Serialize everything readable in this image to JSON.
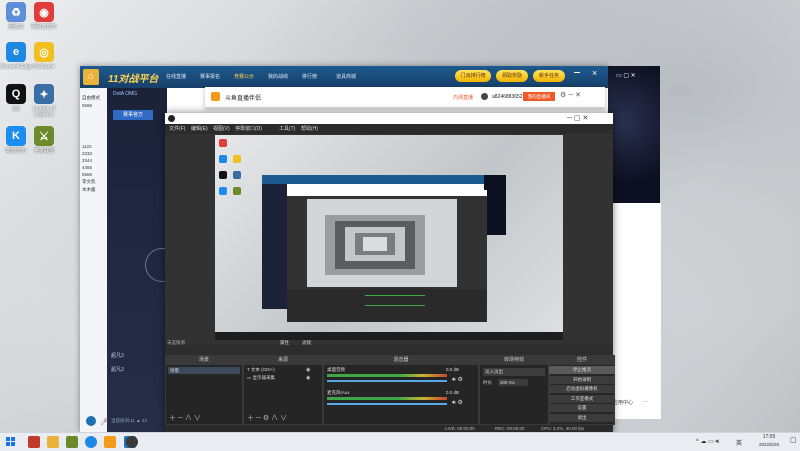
{
  "desktop": {
    "icons": [
      {
        "label": "回收站",
        "color": "#5b8fd6",
        "glyph": "♻"
      },
      {
        "label": "网易云音乐",
        "color": "#e23c3c",
        "glyph": "◉"
      },
      {
        "label": "Microsoft Edge",
        "color": "#1e88e5",
        "glyph": "e"
      },
      {
        "label": "WeGame",
        "color": "#f2c01e",
        "glyph": "◎"
      },
      {
        "label": "QQ",
        "color": "#111111",
        "glyph": "Q"
      },
      {
        "label": "League of Legends",
        "color": "#3a6ea5",
        "glyph": "✦"
      },
      {
        "label": "酷狗音乐",
        "color": "#1c8cf0",
        "glyph": "K"
      },
      {
        "label": "英雄联盟",
        "color": "#6d8a2a",
        "glyph": "⚔"
      }
    ]
  },
  "game_window": {
    "logo": "11对战平台",
    "nav": [
      "在线直播",
      "赛事报名",
      "竞赛公示",
      "我的战绩",
      "排行榜",
      "道具商城"
    ],
    "buttons": [
      "门派排行榜",
      "领取奖励",
      "新手任务"
    ],
    "tab": "DotA OMG",
    "tab2": "视频",
    "sidebar": [
      "自由模式",
      "5566",
      "1122",
      "2233",
      "3344",
      "4455",
      "5566",
      "李文凯",
      "木木酱"
    ],
    "stage_title": "赛事官方",
    "chat": [
      "超凡3",
      "超凡3"
    ],
    "footer": "当前房间:11 ▲ 24"
  },
  "douyu": {
    "title": "斗鱼直播伴侣",
    "right_label": "内测直播",
    "user": "a8246883652",
    "button": "我的直播间"
  },
  "obs": {
    "menu": [
      "文件(F)",
      "编辑(E)",
      "视图(V)",
      "停靠窗口(D)",
      "工具(T)",
      "帮助(H)"
    ],
    "preview_footer": "未选择源",
    "scene_tab_a": "属性",
    "scene_tab_b": "滤镜",
    "docks": {
      "scenes": {
        "title": "场景",
        "items": [
          "场景"
        ]
      },
      "sources": {
        "title": "来源",
        "items": [
          "文本 (GDI+)",
          "显示器采集"
        ]
      },
      "mixer": {
        "title": "混音器",
        "tracks": [
          {
            "name": "桌面音频",
            "db": "0.0 dB"
          },
          {
            "name": "麦克风/Aux",
            "db": "0.0 dB"
          }
        ]
      },
      "transitions": {
        "title": "转场特效",
        "type": "淡入淡出",
        "duration_label": "时长",
        "duration": "300 ms"
      },
      "controls": {
        "title": "控件",
        "buttons": [
          "停止推流",
          "开始录制",
          "启动虚拟摄像机",
          "工作室模式",
          "设置",
          "退出"
        ]
      }
    },
    "status": {
      "live": "LIVE: 00:00:00",
      "rec": "REC: 00:00:00",
      "cpu": "CPU: 3.2%, 30.00 fps"
    }
  },
  "right_panel": {
    "items": [
      "应用中心",
      "···"
    ]
  },
  "taskbar": {
    "time": "17:05",
    "date": "2022/5/28",
    "lang": "英"
  }
}
